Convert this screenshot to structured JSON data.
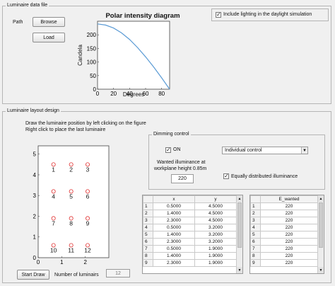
{
  "data_panel": {
    "title": "Luminaire data file",
    "path_label": "Path",
    "browse_label": "Browse",
    "load_label": "Load",
    "lighting_checkbox_label": "Include lighting in the daylight simulation",
    "lighting_checked": true
  },
  "chart_data": {
    "type": "line",
    "title": "Polar intensity diagram",
    "xlabel": "Degrees",
    "ylabel": "Candela",
    "xlim": [
      0,
      90
    ],
    "ylim": [
      0,
      250
    ],
    "xticks": [
      "0",
      "20",
      "40",
      "60",
      "80"
    ],
    "yticks": [
      "0",
      "50",
      "100",
      "150",
      "200"
    ],
    "x": [
      0,
      10,
      20,
      30,
      40,
      50,
      60,
      70,
      80,
      90
    ],
    "y": [
      240,
      236,
      225,
      207,
      183,
      153,
      119,
      82,
      42,
      0
    ],
    "color": "#5b9bd5"
  },
  "layout_panel": {
    "title": "Luminaire layout design",
    "instruction_1": "Draw the luminaire position by left clicking on the figure",
    "instruction_2": "Right click to place the last luminaire",
    "start_draw_label": "Start Draw",
    "num_luminaires_label": "Number of luminairs",
    "num_luminaires_value": "12"
  },
  "layout_plot": {
    "x_ticks": [
      "0",
      "1",
      "2"
    ],
    "y_ticks": [
      "0",
      "1",
      "2",
      "3",
      "4",
      "5"
    ],
    "xlim": [
      0,
      3
    ],
    "ylim": [
      0,
      5.4
    ],
    "marker_color": "#e03030",
    "points": [
      {
        "label": "1",
        "x": 0.65,
        "y": 4.5
      },
      {
        "label": "2",
        "x": 1.4,
        "y": 4.5
      },
      {
        "label": "3",
        "x": 2.1,
        "y": 4.5
      },
      {
        "label": "4",
        "x": 0.65,
        "y": 3.2
      },
      {
        "label": "5",
        "x": 1.4,
        "y": 3.2
      },
      {
        "label": "6",
        "x": 2.1,
        "y": 3.2
      },
      {
        "label": "7",
        "x": 0.65,
        "y": 1.9
      },
      {
        "label": "8",
        "x": 1.4,
        "y": 1.9
      },
      {
        "label": "9",
        "x": 2.1,
        "y": 1.9
      },
      {
        "label": "10",
        "x": 0.65,
        "y": 0.6
      },
      {
        "label": "11",
        "x": 1.4,
        "y": 0.6
      },
      {
        "label": "12",
        "x": 2.1,
        "y": 0.6
      }
    ]
  },
  "dimming": {
    "title": "Dimming control",
    "on_label": "ON",
    "on_checked": true,
    "mode_selected": "Individual control",
    "illuminance_label_1": "Wanted illuminance at",
    "illuminance_label_2": "workplane height 0.85m",
    "illuminance_value": "220",
    "distributed_label": "Equally distributed illuminance",
    "distributed_checked": true
  },
  "xy_table": {
    "headers": [
      "",
      "x",
      "y"
    ],
    "rows": [
      [
        "1",
        "0.5000",
        "4.5000"
      ],
      [
        "2",
        "1.4000",
        "4.5000"
      ],
      [
        "3",
        "2.3000",
        "4.5000"
      ],
      [
        "4",
        "0.5000",
        "3.2000"
      ],
      [
        "5",
        "1.4000",
        "3.2000"
      ],
      [
        "6",
        "2.3000",
        "3.2000"
      ],
      [
        "7",
        "0.5000",
        "1.9000"
      ],
      [
        "8",
        "1.4000",
        "1.9000"
      ],
      [
        "9",
        "2.3000",
        "1.9000"
      ]
    ]
  },
  "e_table": {
    "headers": [
      "",
      "E_wanted"
    ],
    "rows": [
      [
        "1",
        "220"
      ],
      [
        "2",
        "220"
      ],
      [
        "3",
        "220"
      ],
      [
        "4",
        "220"
      ],
      [
        "5",
        "220"
      ],
      [
        "6",
        "220"
      ],
      [
        "7",
        "220"
      ],
      [
        "8",
        "220"
      ],
      [
        "9",
        "220"
      ]
    ]
  }
}
